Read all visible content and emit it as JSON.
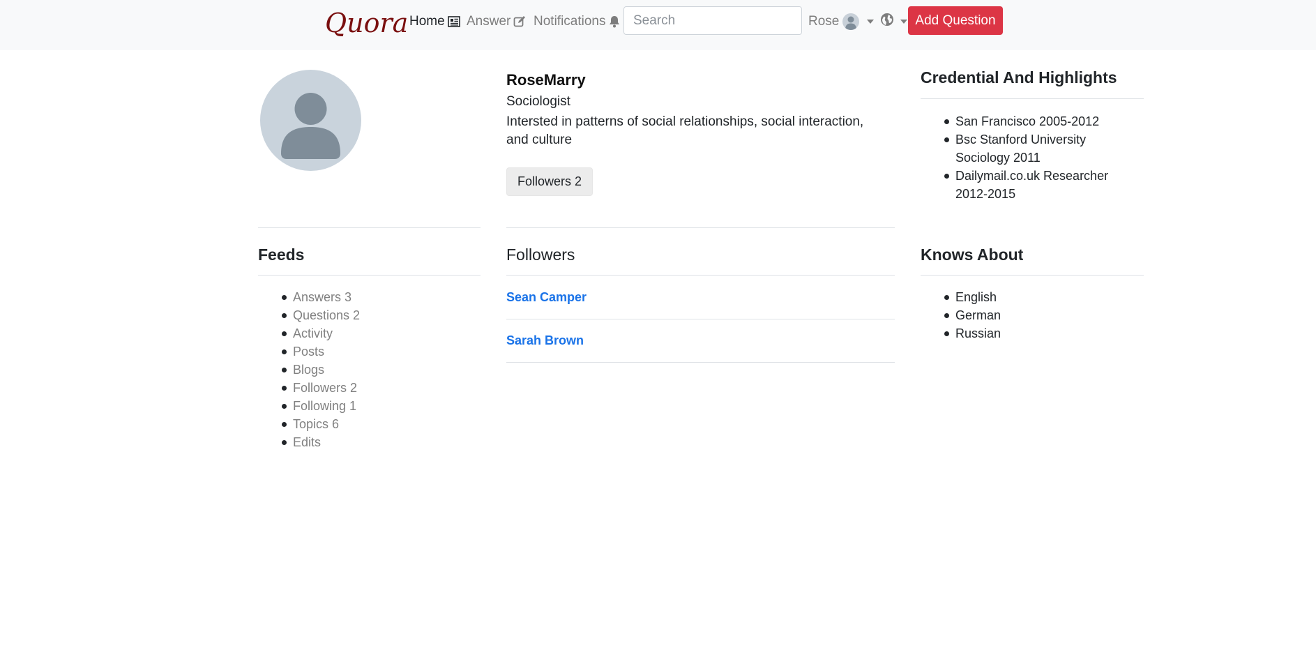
{
  "navbar": {
    "brand": "Quora",
    "home_label": "Home",
    "answer_label": "Answer",
    "notifications_label": "Notifications",
    "search_placeholder": "Search",
    "user_name": "Rose",
    "add_question_label": "Add Question"
  },
  "profile": {
    "name": "RoseMarry",
    "title": "Sociologist",
    "bio": "Intersted in patterns of social relationships, social interaction, and culture",
    "followers_button": "Followers 2"
  },
  "credentials": {
    "title": "Credential And Highlights",
    "items": [
      "San Francisco 2005-2012",
      "Bsc Stanford University Sociology 2011",
      "Dailymail.co.uk Researcher 2012-2015"
    ]
  },
  "feeds": {
    "title": "Feeds",
    "items": [
      "Answers 3",
      "Questions 2",
      "Activity",
      "Posts",
      "Blogs",
      "Followers 2",
      "Following 1",
      "Topics 6",
      "Edits"
    ]
  },
  "followers": {
    "title": "Followers",
    "items": [
      "Sean Camper",
      "Sarah Brown"
    ]
  },
  "knows_about": {
    "title": "Knows About",
    "items": [
      "English",
      "German",
      "Russian"
    ]
  },
  "colors": {
    "brand": "#7a0f0f",
    "danger": "#dc3545",
    "link": "#1a73e8",
    "navbar_bg": "#f8f9fa"
  }
}
